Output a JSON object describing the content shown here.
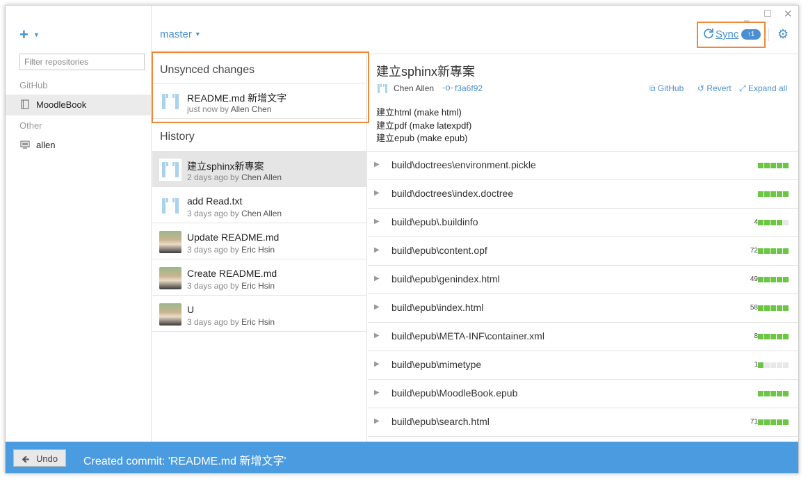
{
  "window": {
    "controls": {
      "minimize": "_",
      "maximize": "☐",
      "close": "✕"
    }
  },
  "sidebar": {
    "add_symbol": "+",
    "filter_placeholder": "Filter repositories",
    "sections": [
      {
        "label": "GitHub",
        "repos": [
          {
            "name": "MoodleBook",
            "icon": "repo-book-icon",
            "active": true
          }
        ]
      },
      {
        "label": "Other",
        "repos": [
          {
            "name": "allen",
            "icon": "computer-icon",
            "active": false
          }
        ]
      }
    ]
  },
  "topbar": {
    "branch": "master",
    "sync_label": "Sync",
    "sync_badge": "↑1"
  },
  "unsynced": {
    "heading": "Unsynced changes",
    "commit": {
      "title": "README.md 新增文字",
      "time": "just now by",
      "author": "Allen Chen"
    }
  },
  "history": {
    "heading": "History",
    "commits": [
      {
        "title": "建立sphinx新專案",
        "time": "2 days ago by",
        "author": "Chen Allen",
        "avatar": "default"
      },
      {
        "title": "add Read.txt",
        "time": "3 days ago by",
        "author": "Chen Allen",
        "avatar": "default"
      },
      {
        "title": "Update README.md",
        "time": "3 days ago by",
        "author": "Eric Hsin",
        "avatar": "photo"
      },
      {
        "title": "Create README.md",
        "time": "3 days ago by",
        "author": "Eric Hsin",
        "avatar": "photo"
      },
      {
        "title": "U",
        "time": "3 days ago by",
        "author": "Eric Hsin",
        "avatar": "photo"
      }
    ]
  },
  "detail": {
    "title": "建立sphinx新專案",
    "author": "Chen Allen",
    "sha": "f3a6f92",
    "actions": {
      "github": "GitHub",
      "revert": "Revert",
      "expand": "Expand all"
    },
    "message_lines": [
      "建立html (make html)",
      "建立pdf (make latexpdf)",
      "建立epub (make epub)"
    ],
    "files": [
      {
        "dir": "build\\doctrees\\",
        "file": "environment.pickle",
        "count": "",
        "bars": 5
      },
      {
        "dir": "build\\doctrees\\",
        "file": "index.doctree",
        "count": "",
        "bars": 5
      },
      {
        "dir": "build\\epub\\",
        "file": ".buildinfo",
        "count": "4",
        "bars": 4
      },
      {
        "dir": "build\\epub\\",
        "file": "content.opf",
        "count": "72",
        "bars": 5
      },
      {
        "dir": "build\\epub\\",
        "file": "genindex.html",
        "count": "49",
        "bars": 5
      },
      {
        "dir": "build\\epub\\",
        "file": "index.html",
        "count": "58",
        "bars": 5
      },
      {
        "dir": "build\\epub\\META-INF\\",
        "file": "container.xml",
        "count": "8",
        "bars": 5
      },
      {
        "dir": "build\\epub\\",
        "file": "mimetype",
        "count": "1",
        "bars": 1
      },
      {
        "dir": "build\\epub\\",
        "file": "MoodleBook.epub",
        "count": "",
        "bars": 5
      },
      {
        "dir": "build\\epub\\",
        "file": "search.html",
        "count": "71",
        "bars": 5
      }
    ]
  },
  "statusbar": {
    "undo_label": "Undo",
    "message": "Created commit: 'README.md 新增文字'"
  },
  "colors": {
    "accent": "#4a90d0",
    "highlight": "#f0883a",
    "status": "#4a9be0",
    "diff_bar": "#6cc644"
  }
}
